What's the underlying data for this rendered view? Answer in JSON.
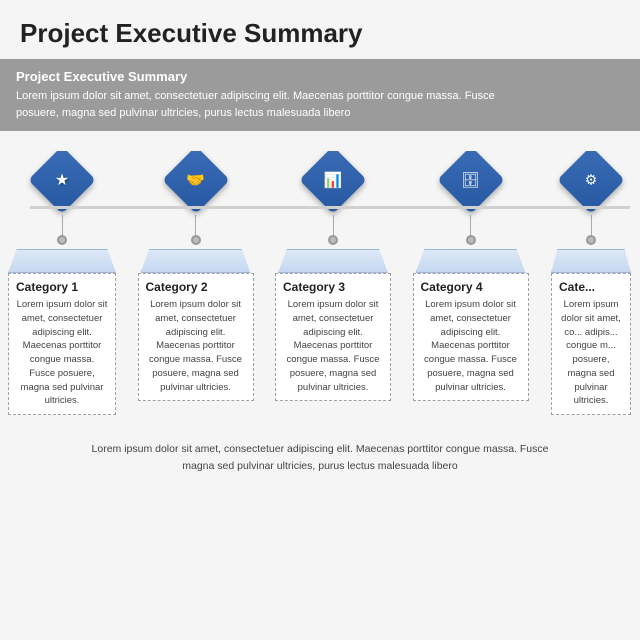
{
  "title": "Project Executive Summary",
  "summary": {
    "heading": "Project Executive Summary",
    "text_line1": "Lorem ipsum dolor sit amet, consectetuer adipiscing elit. Maecenas porttitor congue massa. Fusce",
    "text_line2": "posuere, magna sed pulvinar ultricies, purus lectus malesuada libero"
  },
  "categories": [
    {
      "id": 1,
      "label": "Category 1",
      "icon": "★",
      "text": "Lorem ipsum dolor sit amet, consectetuer adipiscing elit. Maecenas porttitor congue massa. Fusce posuere, magna sed pulvinar ultricies.",
      "visible": true
    },
    {
      "id": 2,
      "label": "Category 2",
      "icon": "🤝",
      "text": "Lorem ipsum dolor sit amet, consectetuer adipiscing elit. Maecenas porttitor congue massa. Fusce posuere, magna sed pulvinar ultricies.",
      "visible": true
    },
    {
      "id": 3,
      "label": "Category 3",
      "icon": "📊",
      "text": "Lorem ipsum dolor sit amet, consectetuer adipiscing elit. Maecenas porttitor congue massa. Fusce posuere, magna sed pulvinar ultricies.",
      "visible": true
    },
    {
      "id": 4,
      "label": "Category 4",
      "icon": "🗄",
      "text": "Lorem ipsum dolor sit amet, consectetuer adipiscing elit. Maecenas porttitor congue massa. Fusce posuere, magna sed pulvinar ultricies.",
      "visible": true
    },
    {
      "id": 5,
      "label": "Cate...",
      "icon": "⚙",
      "text": "Lorem ipsum dolor sit amet, consectetuer adipiscing elit. Maecenas porttitor congue massa. Fusce posuere, magna sed pulvinar ultricies.",
      "visible": true,
      "partial": true
    }
  ],
  "footer": {
    "text_line1": "Lorem ipsum dolor sit amet, consectetuer adipiscing elit. Maecenas porttitor congue massa. Fusce",
    "text_line2": "magna sed pulvinar ultricies, purus lectus malesuada libero"
  },
  "colors": {
    "diamond_blue": "#2d5fa6",
    "timeline_gray": "#c8c8c8",
    "card_border": "#a0a0a0",
    "header_gray": "#9b9b9b"
  }
}
